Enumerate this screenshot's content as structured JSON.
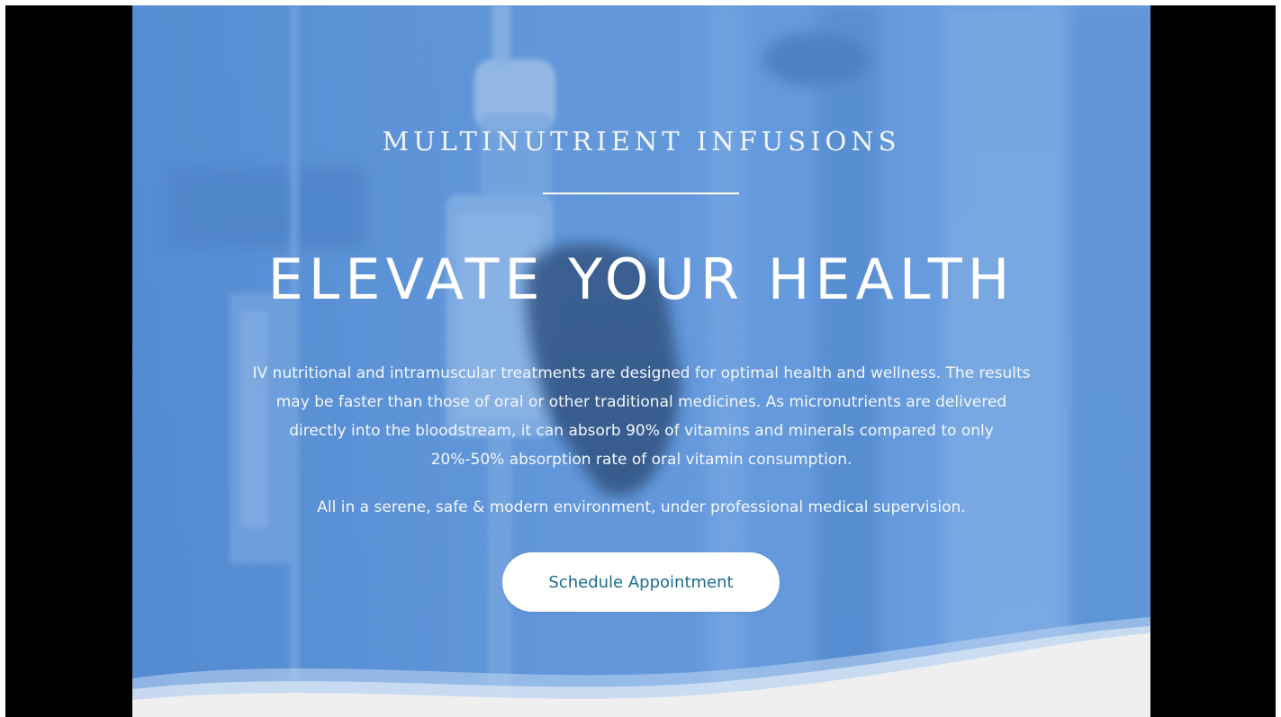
{
  "hero": {
    "eyebrow": "MULTINUTRIENT INFUSIONS",
    "headline": "ELEVATE YOUR HEALTH",
    "body_lines": [
      "IV nutritional and intramuscular treatments are designed for optimal health and wellness. The results",
      "may be faster than those of oral or other traditional medicines. As micronutrients are delivered",
      "directly into the bloodstream, it can absorb 90% of vitamins and minerals compared to only",
      "20%-50% absorption rate of oral vitamin consumption."
    ],
    "tagline": "All in a serene, safe & modern environment, under professional medical supervision.",
    "cta_label": "Schedule Appointment"
  },
  "colors": {
    "hero_blue": "#5d93d6",
    "cta_text": "#1d6c8f",
    "page_bottom": "#efefef",
    "letterbox": "#000000"
  }
}
